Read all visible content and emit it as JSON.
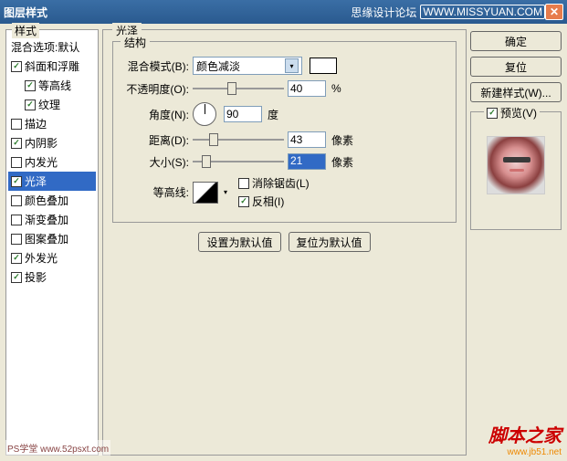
{
  "title": "图层样式",
  "titlebar_right": "思缘设计论坛",
  "titlebar_url": "WWW.MISSYUAN.COM",
  "styles_header": "样式",
  "styles": {
    "blend_default": "混合选项:默认",
    "bevel": "斜面和浮雕",
    "contour": "等高线",
    "texture": "纹理",
    "stroke": "描边",
    "inner_shadow": "内阴影",
    "inner_glow": "内发光",
    "satin": "光泽",
    "color_overlay": "颜色叠加",
    "gradient_overlay": "渐变叠加",
    "pattern_overlay": "图案叠加",
    "outer_glow": "外发光",
    "drop_shadow": "投影"
  },
  "main": {
    "title": "光泽",
    "struct": "结构",
    "blend_mode_label": "混合模式(B):",
    "blend_mode_value": "颜色减淡",
    "opacity_label": "不透明度(O):",
    "opacity_value": "40",
    "opacity_unit": "%",
    "angle_label": "角度(N):",
    "angle_value": "90",
    "angle_unit": "度",
    "distance_label": "距离(D):",
    "distance_value": "43",
    "distance_unit": "像素",
    "size_label": "大小(S):",
    "size_value": "21",
    "size_unit": "像素",
    "contour_label": "等高线:",
    "antialias": "消除锯齿(L)",
    "invert": "反相(I)",
    "set_default": "设置为默认值",
    "reset_default": "复位为默认值"
  },
  "buttons": {
    "ok": "确定",
    "reset": "复位",
    "new_style": "新建样式(W)...",
    "preview": "预览(V)"
  },
  "watermark": {
    "left": "PS学堂  www.52psxt.com",
    "main": "脚本之家",
    "sub": "www.jb51.net"
  }
}
